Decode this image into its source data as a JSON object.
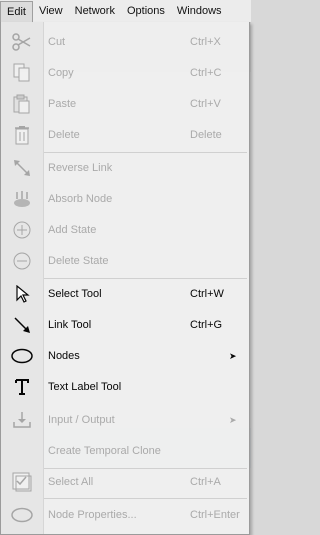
{
  "menubar": {
    "items": [
      {
        "label": "Edit"
      },
      {
        "label": "View"
      },
      {
        "label": "Network"
      },
      {
        "label": "Options"
      },
      {
        "label": "Windows"
      }
    ]
  },
  "edit_menu": {
    "items": [
      {
        "label": "Cut",
        "shortcut": "Ctrl+X",
        "icon": "scissors-icon",
        "enabled": false
      },
      {
        "label": "Copy",
        "shortcut": "Ctrl+C",
        "icon": "copy-icon",
        "enabled": false
      },
      {
        "label": "Paste",
        "shortcut": "Ctrl+V",
        "icon": "paste-icon",
        "enabled": false
      },
      {
        "label": "Delete",
        "shortcut": "Delete",
        "icon": "trash-icon",
        "enabled": false
      },
      {
        "label": "Reverse Link",
        "shortcut": "",
        "icon": "reverse-link-icon",
        "enabled": false
      },
      {
        "label": "Absorb Node",
        "shortcut": "",
        "icon": "absorb-node-icon",
        "enabled": false
      },
      {
        "label": "Add State",
        "shortcut": "",
        "icon": "plus-circle-icon",
        "enabled": false
      },
      {
        "label": "Delete State",
        "shortcut": "",
        "icon": "minus-circle-icon",
        "enabled": false
      },
      {
        "label": "Select Tool",
        "shortcut": "Ctrl+W",
        "icon": "pointer-icon",
        "enabled": true
      },
      {
        "label": "Link Tool",
        "shortcut": "Ctrl+G",
        "icon": "link-arrow-icon",
        "enabled": true
      },
      {
        "label": "Nodes",
        "shortcut": "",
        "icon": "ellipse-icon",
        "enabled": true,
        "submenu": true
      },
      {
        "label": "Text Label Tool",
        "shortcut": "",
        "icon": "text-label-icon",
        "enabled": true
      },
      {
        "label": "Input / Output",
        "shortcut": "",
        "icon": "input-output-icon",
        "enabled": false,
        "submenu": true
      },
      {
        "label": "Create Temporal Clone",
        "shortcut": "",
        "icon": "",
        "enabled": false
      },
      {
        "label": "Select All",
        "shortcut": "Ctrl+A",
        "icon": "select-all-icon",
        "enabled": false
      },
      {
        "label": "Node Properties...",
        "shortcut": "Ctrl+Enter",
        "icon": "node-properties-icon",
        "enabled": false
      }
    ],
    "submenu_arrow": "➤"
  }
}
